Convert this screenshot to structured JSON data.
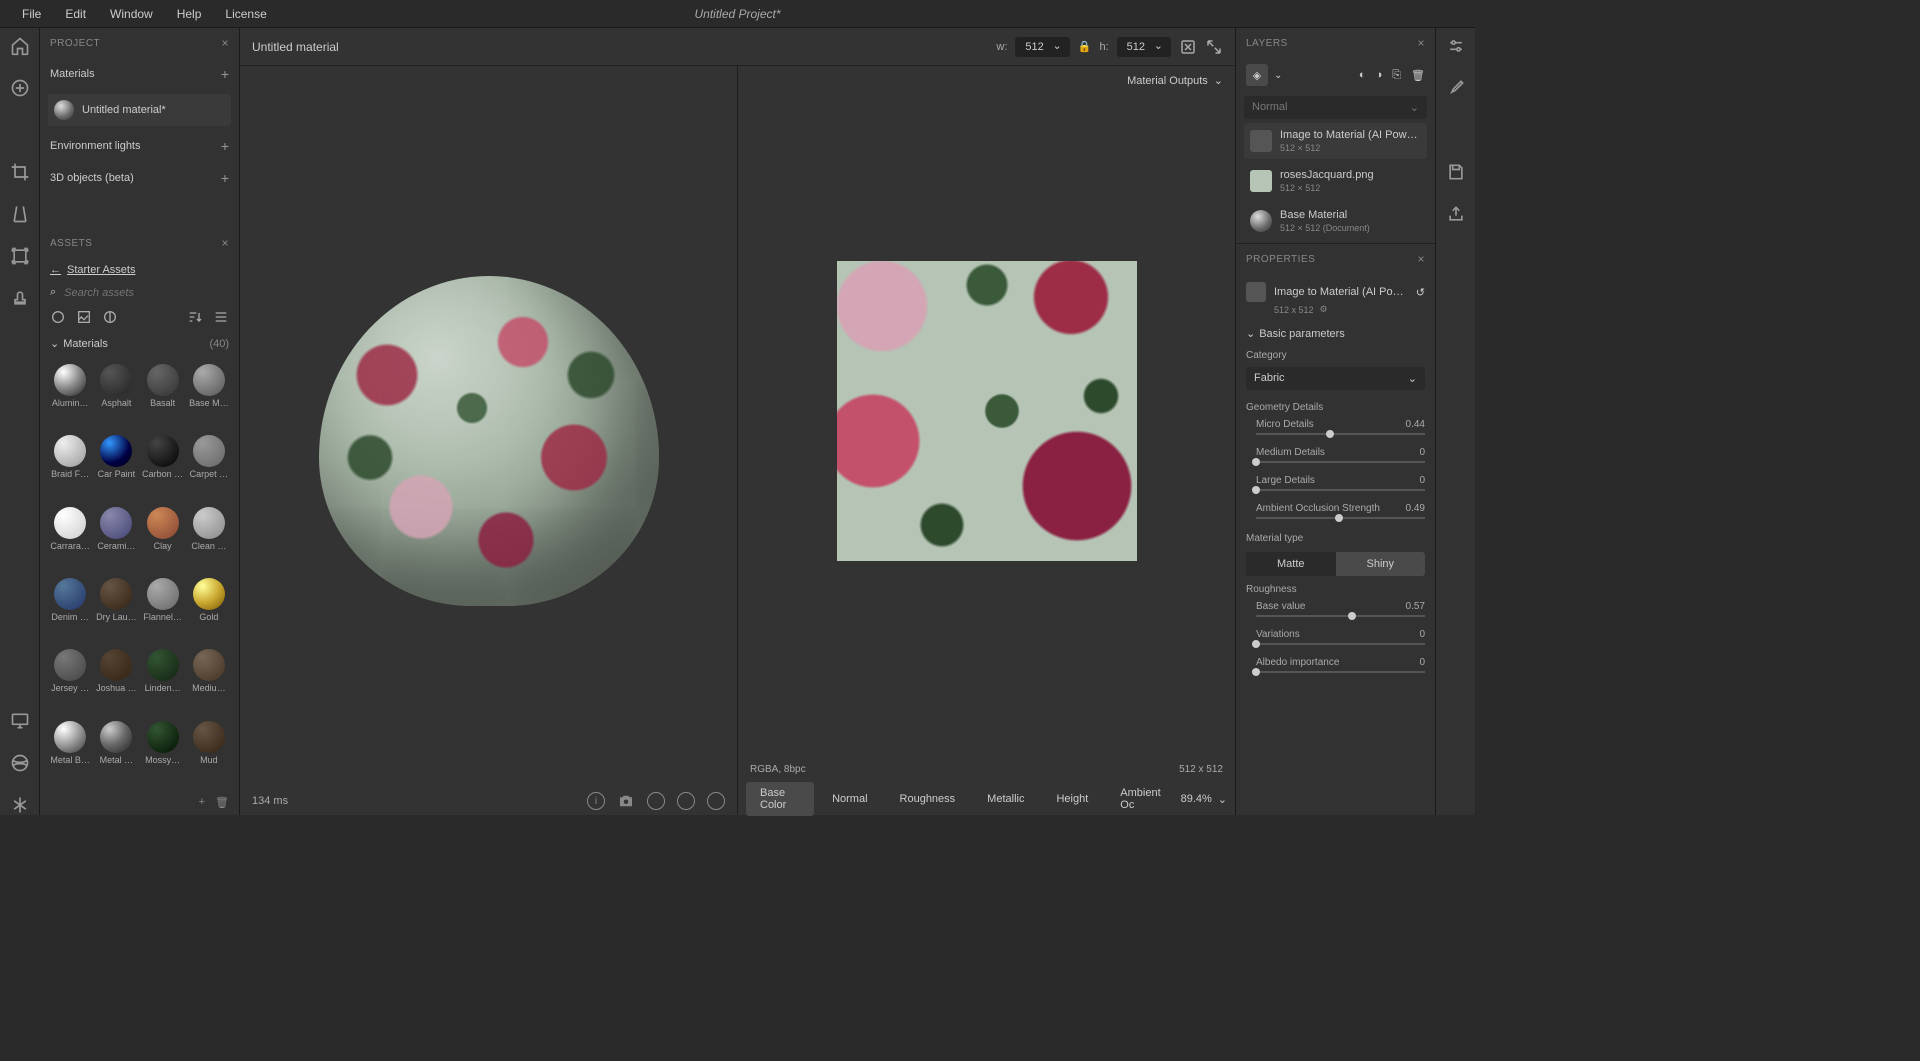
{
  "menubar": {
    "file": "File",
    "edit": "Edit",
    "window": "Window",
    "help": "Help",
    "license": "License"
  },
  "title": "Untitled Project*",
  "project": {
    "header": "PROJECT",
    "materials": "Materials",
    "material_item": "Untitled material*",
    "env_lights": "Environment lights",
    "objects": "3D objects (beta)"
  },
  "assets": {
    "header": "ASSETS",
    "back": "Starter Assets",
    "search_placeholder": "Search assets",
    "cat_label": "Materials",
    "count": "(40)",
    "items": [
      {
        "n": "Alumin…",
        "c": "radial-gradient(circle at 30% 25%,#fff,#888 50%,#222)"
      },
      {
        "n": "Asphalt",
        "c": "radial-gradient(circle at 30% 25%,#555,#222)"
      },
      {
        "n": "Basalt",
        "c": "radial-gradient(circle at 30% 25%,#666,#333)"
      },
      {
        "n": "Base M…",
        "c": "radial-gradient(circle at 30% 25%,#aaa,#555)"
      },
      {
        "n": "Braid F…",
        "c": "radial-gradient(circle at 30% 25%,#eee,#999)"
      },
      {
        "n": "Car Paint",
        "c": "radial-gradient(circle at 30% 25%,#39f,#004 60%,#001)"
      },
      {
        "n": "Carbon …",
        "c": "radial-gradient(circle at 30% 25%,#444,#000)"
      },
      {
        "n": "Carpet …",
        "c": "radial-gradient(circle at 30% 25%,#999,#666)"
      },
      {
        "n": "Carrara…",
        "c": "radial-gradient(circle at 30% 25%,#fff,#ccc)"
      },
      {
        "n": "Cerami…",
        "c": "radial-gradient(circle at 30% 25%,#88a,#447)"
      },
      {
        "n": "Clay",
        "c": "radial-gradient(circle at 30% 25%,#c85,#843)"
      },
      {
        "n": "Clean …",
        "c": "radial-gradient(circle at 30% 25%,#ccc,#888)"
      },
      {
        "n": "Denim …",
        "c": "radial-gradient(circle at 30% 25%,#579,#236)"
      },
      {
        "n": "Dry Lau…",
        "c": "radial-gradient(circle at 30% 25%,#654,#321)"
      },
      {
        "n": "Flannel…",
        "c": "radial-gradient(circle at 30% 25%,#aaa,#666)"
      },
      {
        "n": "Gold",
        "c": "radial-gradient(circle at 30% 25%,#ff9,#ca3 50%,#750)"
      },
      {
        "n": "Jersey …",
        "c": "radial-gradient(circle at 30% 25%,#777,#444)"
      },
      {
        "n": "Joshua …",
        "c": "radial-gradient(circle at 30% 25%,#543,#321)"
      },
      {
        "n": "Linden…",
        "c": "radial-gradient(circle at 30% 25%,#353,#121)"
      },
      {
        "n": "Mediu…",
        "c": "radial-gradient(circle at 30% 25%,#765,#432)"
      },
      {
        "n": "Metal B…",
        "c": "radial-gradient(circle at 30% 25%,#fff,#999 50%,#333)"
      },
      {
        "n": "Metal …",
        "c": "radial-gradient(circle at 30% 25%,#ccc,#666 50%,#222)"
      },
      {
        "n": "Mossy…",
        "c": "radial-gradient(circle at 30% 25%,#353,#010)"
      },
      {
        "n": "Mud",
        "c": "radial-gradient(circle at 30% 25%,#654,#321)"
      }
    ]
  },
  "center": {
    "mat_name": "Untitled material",
    "w_label": "w:",
    "h_label": "h:",
    "w_val": "512",
    "h_val": "512",
    "render_time": "134 ms",
    "mat_outputs": "Material Outputs",
    "format": "RGBA, 8bpc",
    "dims": "512 x 512",
    "zoom": "89.4%"
  },
  "channels": {
    "base_color": "Base Color",
    "normal": "Normal",
    "roughness": "Roughness",
    "metallic": "Metallic",
    "height": "Height",
    "ao": "Ambient Oc"
  },
  "layers": {
    "header": "LAYERS",
    "blend_mode": "Normal",
    "items": [
      {
        "name": "Image to Material (AI Powered)",
        "dim": "512 × 512"
      },
      {
        "name": "rosesJacquard.png",
        "dim": "512 × 512"
      },
      {
        "name": "Base Material",
        "dim": "512 × 512 (Document)"
      }
    ]
  },
  "props": {
    "header": "PROPERTIES",
    "title": "Image to Material (AI Power…",
    "subdim": "512 x 512",
    "basic": "Basic parameters",
    "cat_label": "Category",
    "cat_value": "Fabric",
    "geom_label": "Geometry Details",
    "sliders": [
      {
        "l": "Micro Details",
        "v": "0.44",
        "p": 44
      },
      {
        "l": "Medium Details",
        "v": "0",
        "p": 0
      },
      {
        "l": "Large Details",
        "v": "0",
        "p": 0
      }
    ],
    "ao_label": "Ambient Occlusion Strength",
    "ao_val": "0.49",
    "ao_p": 49,
    "mtype": "Material type",
    "matte": "Matte",
    "shiny": "Shiny",
    "rough_label": "Roughness",
    "rsliders": [
      {
        "l": "Base value",
        "v": "0.57",
        "p": 57
      },
      {
        "l": "Variations",
        "v": "0",
        "p": 0
      },
      {
        "l": "Albedo importance",
        "v": "0",
        "p": 0
      }
    ]
  }
}
